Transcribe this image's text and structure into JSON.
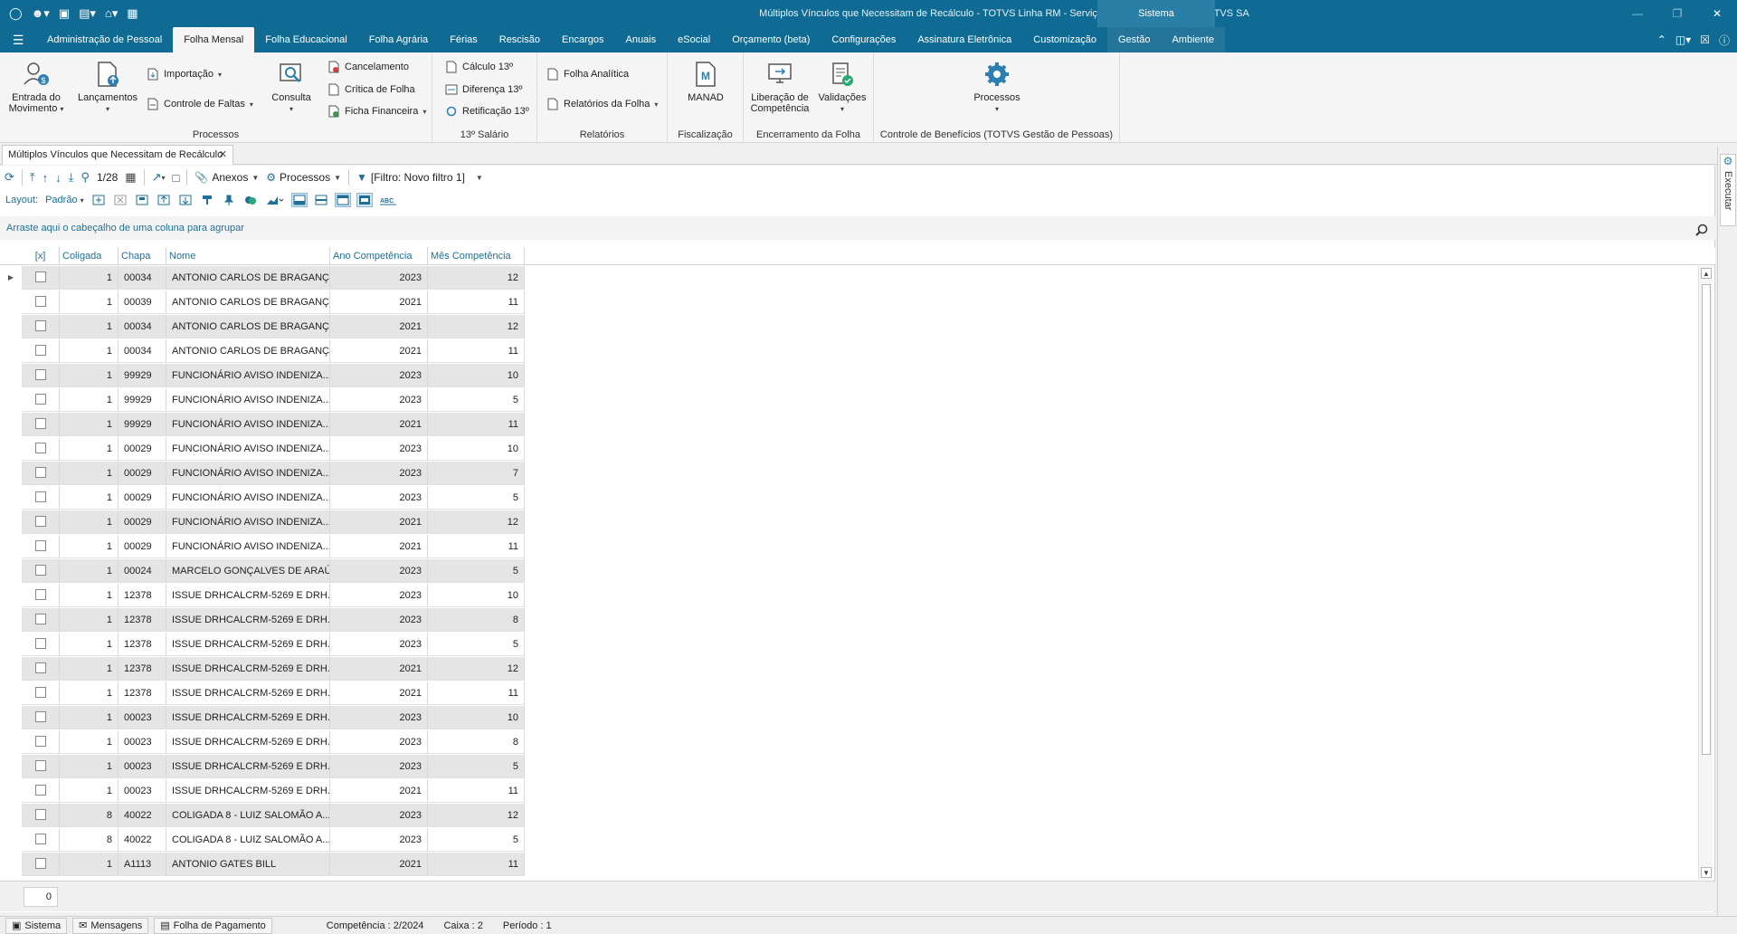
{
  "window": {
    "title": "Múltiplos Vínculos que Necessitam de Recálculo - TOTVS Linha RM - Serviços  Alias: TAE_2410 | 1-TOTVS SA",
    "system_tab": "Sistema"
  },
  "menu": {
    "tabs": [
      "Administração de Pessoal",
      "Folha Mensal",
      "Folha Educacional",
      "Folha Agrária",
      "Férias",
      "Rescisão",
      "Encargos",
      "Anuais",
      "eSocial",
      "Orçamento (beta)",
      "Configurações",
      "Assinatura Eletrônica",
      "Customização",
      "Gestão",
      "Ambiente"
    ],
    "active": "Folha Mensal"
  },
  "ribbon": {
    "processos": {
      "label": "Processos",
      "entrada": "Entrada do Movimento",
      "lancamentos": "Lançamentos",
      "importacao": "Importação",
      "controle_faltas": "Controle de Faltas",
      "consulta": "Consulta",
      "cancelamento": "Cancelamento",
      "critica": "Crítica de Folha",
      "ficha": "Ficha Financeira"
    },
    "salario13": {
      "label": "13º Salário",
      "calculo": "Cálculo 13º",
      "diferenca": "Diferença 13º",
      "retificacao": "Retificação 13º"
    },
    "relatorios": {
      "label": "Relatórios",
      "analitica": "Folha Analítica",
      "relatorios_folha": "Relatórios da Folha"
    },
    "fiscalizacao": {
      "label": "Fiscalização",
      "manad": "MANAD"
    },
    "encerramento": {
      "label": "Encerramento da Folha",
      "liberacao": "Liberação de Competência",
      "validacoes": "Validações"
    },
    "beneficios": {
      "label": "Controle de Benefícios (TOTVS Gestão de Pessoas)",
      "processos": "Processos"
    }
  },
  "doc_tab": {
    "title": "Múltiplos Vínculos que Necessitam de Recálculo"
  },
  "side_panel": {
    "executar": "Executar"
  },
  "toolbar": {
    "record": "1/28",
    "anexos": "Anexos",
    "processos": "Processos",
    "filtro": "[Filtro: Novo filtro 1]",
    "layout_label": "Layout:",
    "layout_value": "Padrão"
  },
  "group_hint": "Arraste aqui o cabeçalho de uma coluna para agrupar",
  "grid": {
    "columns": [
      "[x]",
      "Coligada",
      "Chapa",
      "Nome",
      "Ano Competência",
      "Mês Competência"
    ],
    "rows": [
      [
        "1",
        "00034",
        "ANTONIO CARLOS DE BRAGANÇA",
        "2023",
        "12"
      ],
      [
        "1",
        "00039",
        "ANTONIO CARLOS DE BRAGANÇA",
        "2021",
        "11"
      ],
      [
        "1",
        "00034",
        "ANTONIO CARLOS DE BRAGANÇA",
        "2021",
        "12"
      ],
      [
        "1",
        "00034",
        "ANTONIO CARLOS DE BRAGANÇA",
        "2021",
        "11"
      ],
      [
        "1",
        "99929",
        "FUNCIONÁRIO AVISO INDENIZA...",
        "2023",
        "10"
      ],
      [
        "1",
        "99929",
        "FUNCIONÁRIO AVISO INDENIZA...",
        "2023",
        "5"
      ],
      [
        "1",
        "99929",
        "FUNCIONÁRIO AVISO INDENIZA...",
        "2021",
        "11"
      ],
      [
        "1",
        "00029",
        "FUNCIONÁRIO AVISO INDENIZA...",
        "2023",
        "10"
      ],
      [
        "1",
        "00029",
        "FUNCIONÁRIO AVISO INDENIZA...",
        "2023",
        "7"
      ],
      [
        "1",
        "00029",
        "FUNCIONÁRIO AVISO INDENIZA...",
        "2023",
        "5"
      ],
      [
        "1",
        "00029",
        "FUNCIONÁRIO AVISO INDENIZA...",
        "2021",
        "12"
      ],
      [
        "1",
        "00029",
        "FUNCIONÁRIO AVISO INDENIZA...",
        "2021",
        "11"
      ],
      [
        "1",
        "00024",
        "MARCELO GONÇALVES DE ARAÚ...",
        "2023",
        "5"
      ],
      [
        "1",
        "12378",
        "ISSUE DRHCALCRM-5269 E DRH...",
        "2023",
        "10"
      ],
      [
        "1",
        "12378",
        "ISSUE DRHCALCRM-5269 E DRH...",
        "2023",
        "8"
      ],
      [
        "1",
        "12378",
        "ISSUE DRHCALCRM-5269 E DRH...",
        "2023",
        "5"
      ],
      [
        "1",
        "12378",
        "ISSUE DRHCALCRM-5269 E DRH...",
        "2021",
        "12"
      ],
      [
        "1",
        "12378",
        "ISSUE DRHCALCRM-5269 E DRH...",
        "2021",
        "11"
      ],
      [
        "1",
        "00023",
        "ISSUE DRHCALCRM-5269 E DRH...",
        "2023",
        "10"
      ],
      [
        "1",
        "00023",
        "ISSUE DRHCALCRM-5269 E DRH...",
        "2023",
        "8"
      ],
      [
        "1",
        "00023",
        "ISSUE DRHCALCRM-5269 E DRH...",
        "2023",
        "5"
      ],
      [
        "1",
        "00023",
        "ISSUE DRHCALCRM-5269 E DRH...",
        "2021",
        "11"
      ],
      [
        "8",
        "40022",
        "COLIGADA 8 - LUIZ SALOMÃO A...",
        "2023",
        "12"
      ],
      [
        "8",
        "40022",
        "COLIGADA 8 - LUIZ SALOMÃO A...",
        "2023",
        "5"
      ],
      [
        "1",
        "A1113",
        "ANTONIO GATES BILL",
        "2021",
        "11"
      ]
    ],
    "footer_count": "0"
  },
  "status": {
    "sistema": "Sistema",
    "mensagens": "Mensagens",
    "folha": "Folha de Pagamento",
    "competencia": "Competência : 2/2024",
    "caixa": "Caixa : 2",
    "periodo": "Período : 1"
  },
  "colors": {
    "brand": "#0f6b93",
    "accent": "#1f6f96",
    "alt_row": "#e5e5e5"
  }
}
